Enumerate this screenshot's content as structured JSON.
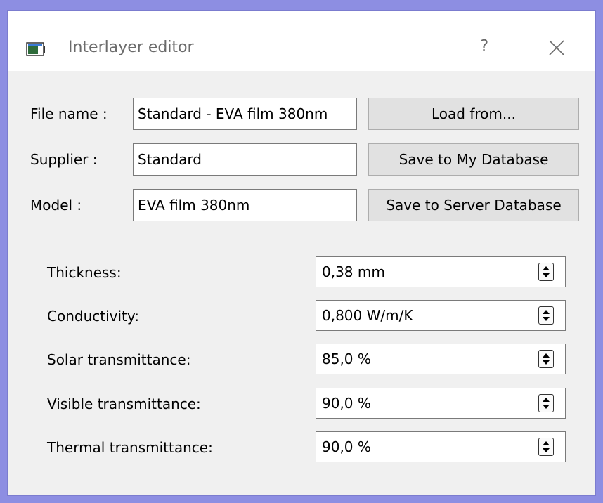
{
  "window": {
    "title": "Interlayer editor",
    "help_label": "?",
    "icon": "app-window-icon",
    "close_icon": "close-icon"
  },
  "header_fields": [
    {
      "label": "File name :",
      "value": "Standard - EVA film 380nm"
    },
    {
      "label": "Supplier :",
      "value": "Standard"
    },
    {
      "label": "Model :",
      "value": "EVA film 380nm"
    }
  ],
  "buttons": {
    "load_from": "Load from...",
    "save_my_db": "Save to My Database",
    "save_server_db": "Save to Server Database"
  },
  "properties": [
    {
      "label": "Thickness:",
      "value": "0,38 mm"
    },
    {
      "label": "Conductivity:",
      "value": "0,800 W/m/K"
    },
    {
      "label": "Solar transmittance:",
      "value": "85,0 %"
    },
    {
      "label": "Visible transmittance:",
      "value": "90,0 %"
    },
    {
      "label": "Thermal transmittance:",
      "value": "90,0 %"
    }
  ],
  "colors": {
    "desktop": "#8d8ee2",
    "window_bg": "#f0f0f0",
    "button_bg": "#e1e1e1"
  }
}
